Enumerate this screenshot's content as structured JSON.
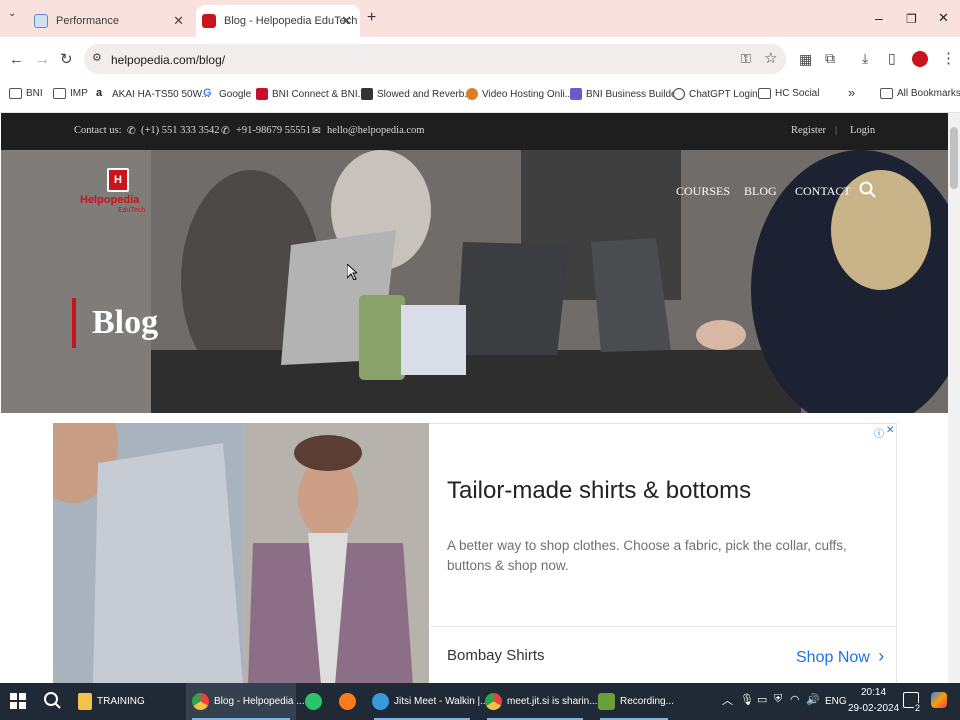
{
  "browser": {
    "tabs": [
      {
        "title": "Performance",
        "active": false
      },
      {
        "title": "Blog - Helpopedia EduTech",
        "active": true
      }
    ],
    "new_tab": "+",
    "window_controls": {
      "minimize": "–",
      "restore": "❐",
      "close": "✕"
    },
    "url": "helpopedia.com/blog/",
    "bookmarks": [
      "BNI",
      "IMP",
      "AKAI HA-TS50 50W...",
      "Google",
      "BNI Connect & BNI...",
      "Slowed and Reverb...",
      "Video Hosting Onli...",
      "BNI Business Builder",
      "ChatGPT Login",
      "HC Social"
    ],
    "bookmarks_overflow": "»",
    "all_bookmarks": "All Bookmarks"
  },
  "site": {
    "contact_label": "Contact us:",
    "phone1": "(+1) 551 333 3542",
    "phone2": "+91-98679 55551",
    "email": "hello@helpopedia.com",
    "register": "Register",
    "login": "Login",
    "nav": [
      "COURSES",
      "BLOG",
      "CONTACT"
    ],
    "logo_text": "Helpopedia",
    "logo_sub": "EduTech",
    "hero_title": "Blog"
  },
  "ad": {
    "headline": "Tailor-made shirts & bottoms",
    "body": "A better way to shop clothes. Choose a fabric, pick the collar, cuffs, buttons & shop now.",
    "brand": "Bombay Shirts",
    "cta": "Shop Now",
    "cta_arrow": "›",
    "close": "✕"
  },
  "taskbar": {
    "items": [
      {
        "label": "TRAINING",
        "color": "#f3c24a"
      },
      {
        "label": "Blog - Helpopedia ...",
        "color": "#e8443a"
      },
      {
        "label": "",
        "color": "#2cc36b"
      },
      {
        "label": "",
        "color": "#ff7a1a"
      },
      {
        "label": "Jitsi Meet - Walkin |...",
        "color": "#3a9ad9"
      },
      {
        "label": "meet.jit.si is sharin...",
        "color": "#e8443a"
      },
      {
        "label": "Recording...",
        "color": "#6a9f3a"
      }
    ],
    "lang": "ENG",
    "time": "20:14",
    "date": "29-02-2024",
    "notifications": "2"
  }
}
